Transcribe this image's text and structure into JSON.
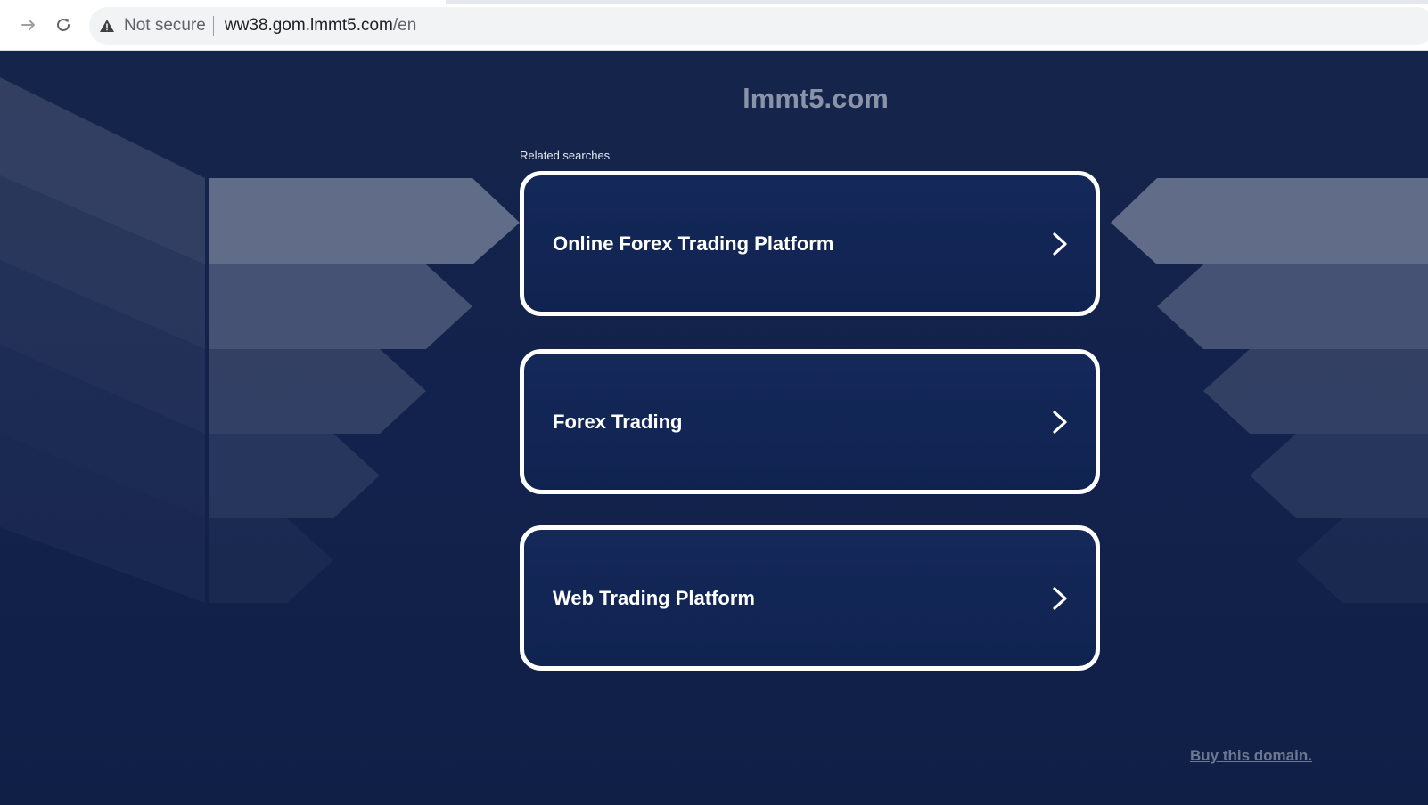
{
  "browser": {
    "security_label": "Not secure",
    "url_host": "ww38.gom.lmmt5.com",
    "url_path": "/en",
    "icons": {
      "forward": "arrow-right-icon",
      "reload": "reload-icon",
      "security": "warning-triangle-icon"
    }
  },
  "page": {
    "title": "lmmt5.com",
    "related_label": "Related searches",
    "searches": [
      {
        "label": "Online Forex Trading Platform"
      },
      {
        "label": "Forex Trading"
      },
      {
        "label": "Web Trading Platform"
      }
    ],
    "buy_link": "Buy this domain."
  },
  "colors": {
    "page_background": "#12214a",
    "card_background": "#12254f",
    "card_border": "#ffffff",
    "title_text": "#8b93a8",
    "link_text": "#6e7791"
  }
}
